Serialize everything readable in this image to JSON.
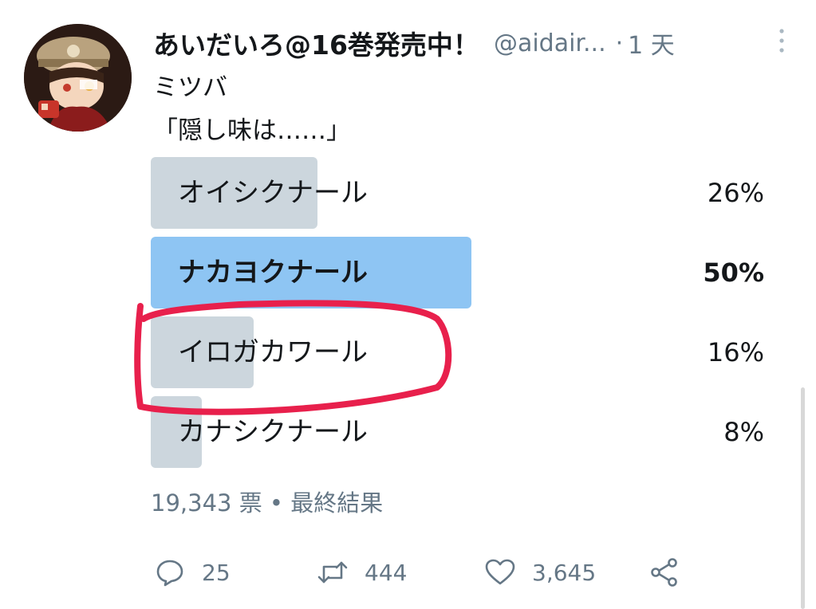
{
  "tweet": {
    "display_name": "あいだいろ@16巻発売中！",
    "handle": "@aidair...",
    "separator": "·",
    "time": "1 天",
    "text_line1": "ミツバ",
    "text_line2": "「隠し味は……」"
  },
  "poll": {
    "options": [
      {
        "label": "オイシクナール",
        "percent_text": "26%",
        "percent": 26,
        "winner": false
      },
      {
        "label": "ナカヨクナール",
        "percent_text": "50%",
        "percent": 50,
        "winner": true
      },
      {
        "label": "イロガカワール",
        "percent_text": "16%",
        "percent": 16,
        "winner": false
      },
      {
        "label": "カナシクナール",
        "percent_text": "8%",
        "percent": 8,
        "winner": false
      }
    ],
    "votes": "19,343 票",
    "meta_separator": "•",
    "status": "最終結果"
  },
  "actions": {
    "reply_count": "25",
    "retweet_count": "444",
    "like_count": "3,645"
  },
  "icons": [
    "avatar",
    "more-vertical-icon",
    "reply-icon",
    "retweet-icon",
    "like-icon",
    "share-icon"
  ],
  "colors": {
    "bar": "#ccd6dd",
    "winner_bar": "#8ec5f3",
    "secondary_text": "#657786",
    "highlight": "#e8204c"
  }
}
